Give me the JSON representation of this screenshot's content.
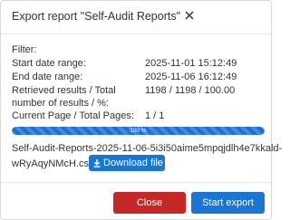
{
  "dialog": {
    "title": "Export report \"Self-Audit Reports\"",
    "filter_label": "Filter:",
    "rows": [
      {
        "label": "Start date range:",
        "value": "2025-11-01 15:12:49"
      },
      {
        "label": "End date range:",
        "value": "2025-11-06 16:12:49"
      },
      {
        "label": "Retrieved results / Total",
        "value": "1198 / 1198 / 100.00"
      },
      {
        "label": "number of results / %:",
        "value": ""
      },
      {
        "label": "Current Page / Total Pages:",
        "value": "1 / 1"
      }
    ],
    "progress": {
      "percent": 100,
      "label": "100 %"
    },
    "file": {
      "name_line1": "Self-Audit-Reports-2025-11-06-5i3i50aime5mpqjdlh4e7kkald-",
      "name_line2": "wRyAqyNMcH.csv",
      "download_label": "Download file"
    },
    "buttons": {
      "close_label": "Close",
      "start_label": "Start export"
    }
  },
  "colors": {
    "primary": "#1976d2",
    "danger": "#c62828",
    "progress": "#1e6fd9"
  },
  "icons": {
    "close": "close-icon",
    "download": "download-icon"
  }
}
